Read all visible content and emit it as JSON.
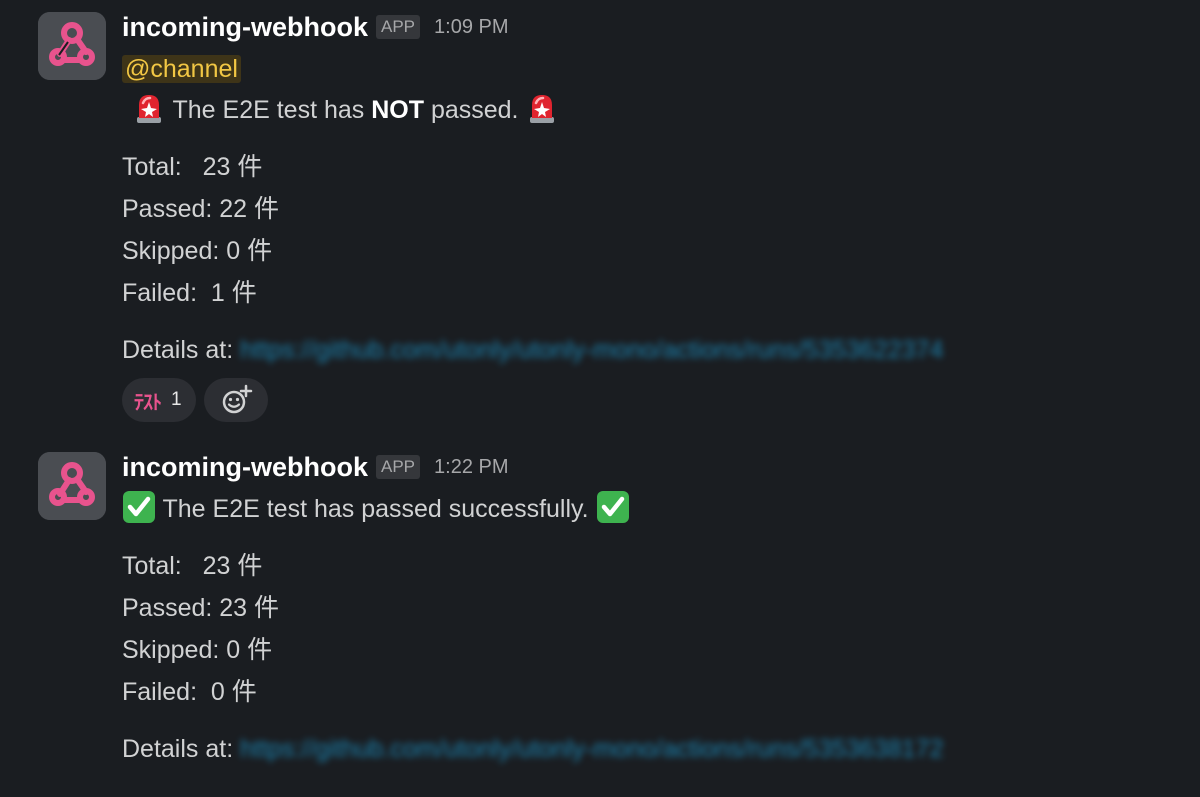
{
  "messages": [
    {
      "sender": "incoming-webhook",
      "badge": "APP",
      "time": "1:09 PM",
      "mention": "@channel",
      "status_emoji": "rotating-light",
      "status_pre": " The E2E test has ",
      "status_bold": "NOT",
      "status_post": " passed. ",
      "total": "Total:   23 件",
      "passed": "Passed: 22 件",
      "skipped": "Skipped: 0 件",
      "failed": "Failed:  1 件",
      "details_label": "Details at:",
      "details_link": "https://github.com/utonly/utonly-mono/actions/runs/5353622374",
      "reactions": [
        {
          "emoji_text": "ﾃｽﾄ",
          "count": "1"
        }
      ]
    },
    {
      "sender": "incoming-webhook",
      "badge": "APP",
      "time": "1:22 PM",
      "status_emoji": "white-check-mark",
      "status_text": " The E2E test has passed successfully. ",
      "total": "Total:   23 件",
      "passed": "Passed: 23 件",
      "skipped": "Skipped: 0 件",
      "failed": "Failed:  0 件",
      "details_label": "Details at:",
      "details_link": "https://github.com/utonly/utonly-mono/actions/runs/5353638172"
    }
  ],
  "colors": {
    "background": "#1a1d21",
    "text": "#d1d2d3",
    "mention_bg": "#3e3418",
    "mention_text": "#f2c744",
    "link": "#1d9bd1",
    "webhook_pink": "#e8538d",
    "check_green": "#3eb34f",
    "siren_red": "#e0242f"
  }
}
